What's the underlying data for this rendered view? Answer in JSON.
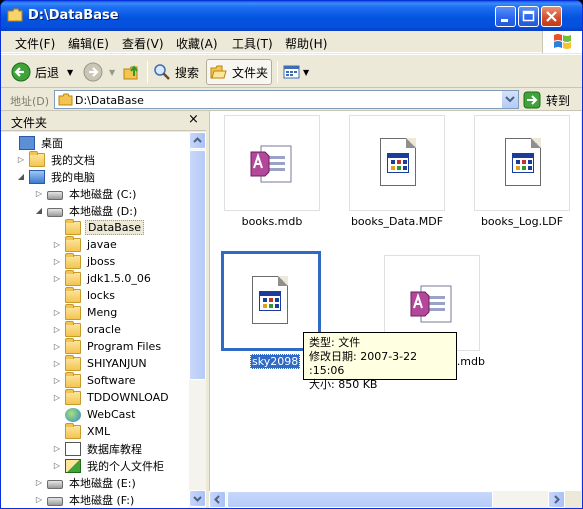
{
  "window": {
    "title": "D:\\DataBase"
  },
  "menu": [
    "文件(F)",
    "编辑(E)",
    "查看(V)",
    "收藏(A)",
    "工具(T)",
    "帮助(H)"
  ],
  "toolbar": {
    "back": "后退",
    "search": "搜索",
    "folders": "文件夹"
  },
  "address": {
    "label": "地址(D)",
    "path": "D:\\DataBase",
    "go": "转到"
  },
  "pane": {
    "title": "文件夹",
    "close": "×",
    "tree": [
      {
        "label": "桌面",
        "level": 0,
        "icon": "desktop-icon",
        "exp": ""
      },
      {
        "label": "我的文档",
        "level": 1,
        "icon": "my-documents-icon",
        "exp": "▷"
      },
      {
        "label": "我的电脑",
        "level": 1,
        "icon": "my-computer-icon",
        "exp": "◢"
      },
      {
        "label": "本地磁盘 (C:)",
        "level": 2,
        "icon": "drive-icon",
        "exp": "▷"
      },
      {
        "label": "本地磁盘 (D:)",
        "level": 2,
        "icon": "drive-icon",
        "exp": "◢"
      },
      {
        "label": "DataBase",
        "level": 3,
        "icon": "folder-open-icon",
        "exp": "",
        "selected": true
      },
      {
        "label": "javae",
        "level": 3,
        "icon": "folder-icon",
        "exp": "▷"
      },
      {
        "label": "jboss",
        "level": 3,
        "icon": "folder-icon",
        "exp": "▷"
      },
      {
        "label": "jdk1.5.0_06",
        "level": 3,
        "icon": "folder-icon",
        "exp": "▷"
      },
      {
        "label": "locks",
        "level": 3,
        "icon": "folder-icon",
        "exp": ""
      },
      {
        "label": "Meng",
        "level": 3,
        "icon": "folder-icon",
        "exp": "▷"
      },
      {
        "label": "oracle",
        "level": 3,
        "icon": "folder-icon",
        "exp": "▷"
      },
      {
        "label": "Program Files",
        "level": 3,
        "icon": "folder-icon",
        "exp": "▷"
      },
      {
        "label": "SHIYANJUN",
        "level": 3,
        "icon": "folder-icon",
        "exp": "▷"
      },
      {
        "label": "Software",
        "level": 3,
        "icon": "shared-folder-icon",
        "exp": "▷"
      },
      {
        "label": "TDDOWNLOAD",
        "level": 3,
        "icon": "folder-icon",
        "exp": "▷"
      },
      {
        "label": "WebCast",
        "level": 3,
        "icon": "globe-icon",
        "exp": ""
      },
      {
        "label": "XML",
        "level": 3,
        "icon": "folder-icon",
        "exp": ""
      },
      {
        "label": "数据库教程",
        "level": 3,
        "icon": "document-folder-icon",
        "exp": "▷"
      },
      {
        "label": "我的个人文件柜",
        "level": 3,
        "icon": "green-arrow-folder-icon",
        "exp": "▷"
      },
      {
        "label": "本地磁盘 (E:)",
        "level": 2,
        "icon": "drive-icon",
        "exp": "▷"
      },
      {
        "label": "本地磁盘 (F:)",
        "level": 2,
        "icon": "drive-icon",
        "exp": "▷"
      }
    ]
  },
  "files": [
    {
      "name": "books.mdb",
      "type": "access",
      "selected": false
    },
    {
      "name": "books_Data.MDF",
      "type": "app",
      "selected": false
    },
    {
      "name": "books_Log.LDF",
      "type": "app",
      "selected": false
    },
    {
      "name": "sky2098",
      "type": "app",
      "selected": true
    },
    {
      "name": "n.mdb",
      "type": "access",
      "selected": false
    }
  ],
  "tooltip": {
    "line1": "类型: 文件",
    "line2": "修改日期: 2007-3-22 :15:06",
    "line3": "大小: 850 KB"
  },
  "colors": {
    "titlebar": "#0454e0",
    "selection": "#316ac5",
    "tooltip": "#ffffe1"
  }
}
